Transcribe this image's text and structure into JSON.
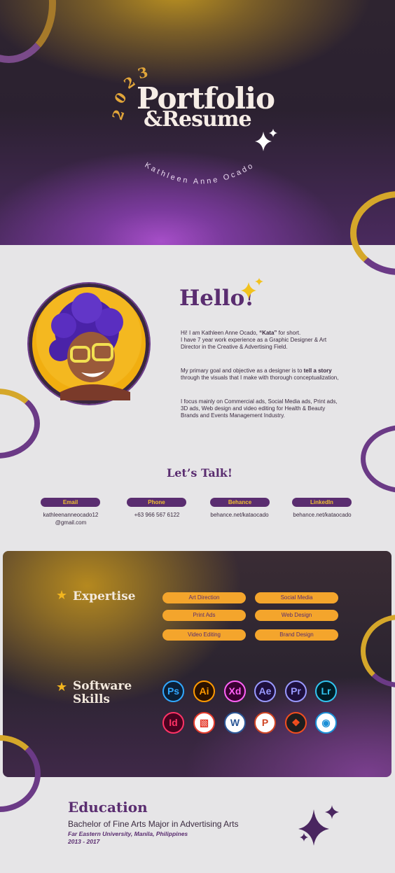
{
  "hero": {
    "year": "2023",
    "title_line1": "Portfolio",
    "title_line2": "&Resume",
    "name": "Kathleen Anne Ocado"
  },
  "about": {
    "greeting": "Hello!",
    "p1_a": "Hi! I am Kathleen Anne Ocado, ",
    "p1_nick": "“Kata”",
    "p1_b": " for short.",
    "p1_c": "I have 7 year work experience as a Graphic Designer & Art Director in the Creative & Advertising Field.",
    "p2_a": "My primary goal and objective as a designer is to ",
    "p2_bold": "tell a story",
    "p2_b": " through the visuals that I make with thorough conceptualization,",
    "p3": "I focus mainly on Commercial ads, Social Media ads, Print ads, 3D ads, Web design and video editing for Health & Beauty Brands and Events Management Industry."
  },
  "contact": {
    "heading": "Let’s Talk!",
    "items": [
      {
        "label": "Email",
        "value": "kathleenanneocado12\n@gmail.com"
      },
      {
        "label": "Phone",
        "value": "+63 966 567 6122"
      },
      {
        "label": "Behance",
        "value": "behance.net/kataocado"
      },
      {
        "label": "LinkedIn",
        "value": "behance.net/kataocado"
      }
    ]
  },
  "expertise": {
    "heading": "Expertise",
    "tags": [
      "Art Direction",
      "Social Media",
      "Print Ads",
      "Web Design",
      "Video Editing",
      "Brand Design"
    ]
  },
  "software": {
    "heading_line1": "Software",
    "heading_line2": "Skills",
    "apps": [
      {
        "icon": "photoshop-icon",
        "text": "Ps",
        "bg": "#0b1f36",
        "fg": "#31a8ff"
      },
      {
        "icon": "illustrator-icon",
        "text": "Ai",
        "bg": "#2b1200",
        "fg": "#ff9a00"
      },
      {
        "icon": "xd-icon",
        "text": "Xd",
        "bg": "#3a0032",
        "fg": "#ff61f6"
      },
      {
        "icon": "after-effects-icon",
        "text": "Ae",
        "bg": "#1e0f3e",
        "fg": "#9999ff"
      },
      {
        "icon": "premiere-icon",
        "text": "Pr",
        "bg": "#1e0f3e",
        "fg": "#9999ff"
      },
      {
        "icon": "lightroom-icon",
        "text": "Lr",
        "bg": "#001d26",
        "fg": "#31c5f0"
      },
      {
        "icon": "indesign-icon",
        "text": "Id",
        "bg": "#49021f",
        "fg": "#ff3366"
      },
      {
        "icon": "sketchup-icon",
        "text": "▧",
        "bg": "#ffffff",
        "fg": "#e53b2c"
      },
      {
        "icon": "word-icon",
        "text": "W",
        "bg": "#ffffff",
        "fg": "#2b5797"
      },
      {
        "icon": "powerpoint-icon",
        "text": "P",
        "bg": "#ffffff",
        "fg": "#d04423"
      },
      {
        "icon": "figma-icon",
        "text": "❖",
        "bg": "#1e1e1e",
        "fg": "#f24e1e"
      },
      {
        "icon": "keyshot-icon",
        "text": "◉",
        "bg": "#ffffff",
        "fg": "#1a8fd6"
      }
    ]
  },
  "education": {
    "heading": "Education",
    "degree": "Bachelor of Fine Arts Major in Advertising Arts",
    "school": "Far Eastern University, Manila, Philippines",
    "years": "2013 - 2017"
  },
  "colors": {
    "purple": "#5a2d70",
    "gold": "#f4a52c",
    "background": "#e6e5e7"
  }
}
